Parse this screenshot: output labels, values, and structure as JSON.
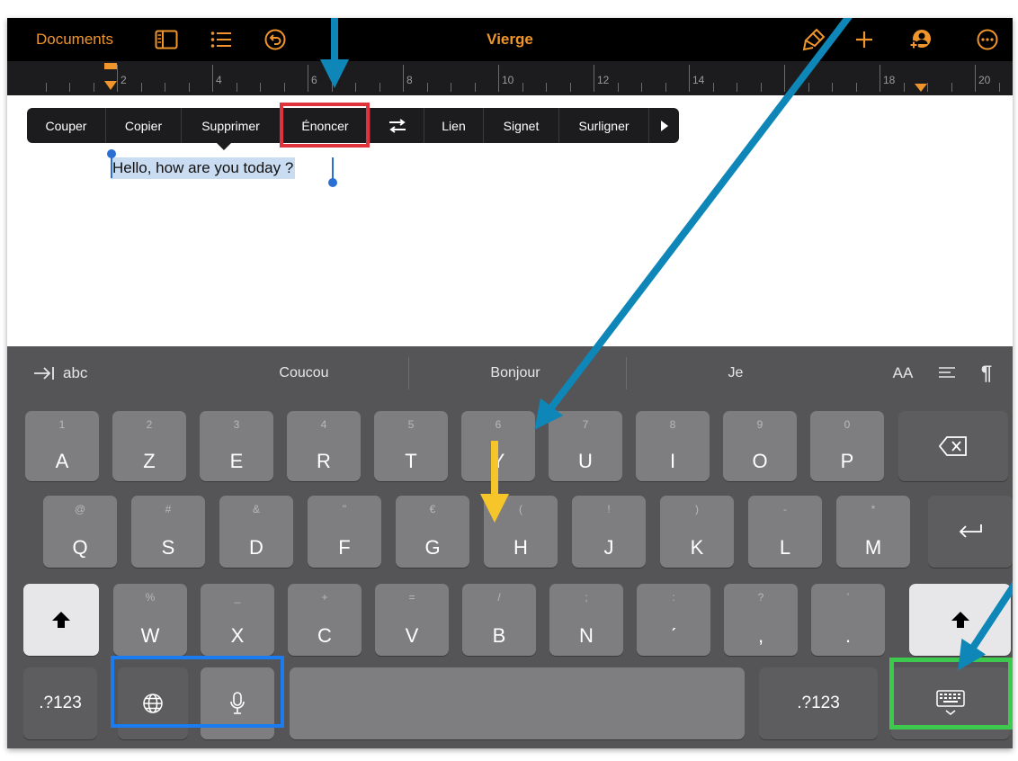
{
  "toolbar": {
    "documents_label": "Documents",
    "title": "Vierge",
    "icons": [
      "sidebar-icon",
      "list-icon",
      "undo-icon",
      "brush-icon",
      "plus-icon",
      "collaborate-icon",
      "more-icon"
    ]
  },
  "ruler": {
    "labels": [
      "2",
      "4",
      "6",
      "8",
      "10",
      "12",
      "14",
      "18",
      "20"
    ]
  },
  "edit_menu": {
    "items": [
      "Couper",
      "Copier",
      "Supprimer",
      "Énoncer",
      "",
      "Lien",
      "Signet",
      "Surligner",
      ""
    ],
    "highlighted_item": "Énoncer"
  },
  "document": {
    "selected_text": "Hello, how are you today ?"
  },
  "keyboard": {
    "predictions": {
      "tab_label": "abc",
      "words": [
        "Coucou",
        "Bonjour",
        "Je"
      ],
      "format_label": "AA"
    },
    "row1": [
      {
        "sub": "1",
        "main": "A"
      },
      {
        "sub": "2",
        "main": "Z"
      },
      {
        "sub": "3",
        "main": "E"
      },
      {
        "sub": "4",
        "main": "R"
      },
      {
        "sub": "5",
        "main": "T"
      },
      {
        "sub": "6",
        "main": "Y"
      },
      {
        "sub": "7",
        "main": "U"
      },
      {
        "sub": "8",
        "main": "I"
      },
      {
        "sub": "9",
        "main": "O"
      },
      {
        "sub": "0",
        "main": "P"
      }
    ],
    "row2": [
      {
        "sub": "@",
        "main": "Q"
      },
      {
        "sub": "#",
        "main": "S"
      },
      {
        "sub": "&",
        "main": "D"
      },
      {
        "sub": "\"",
        "main": "F"
      },
      {
        "sub": "€",
        "main": "G"
      },
      {
        "sub": "(",
        "main": "H"
      },
      {
        "sub": "!",
        "main": "J"
      },
      {
        "sub": ")",
        "main": "K"
      },
      {
        "sub": "-",
        "main": "L"
      },
      {
        "sub": "*",
        "main": "M"
      }
    ],
    "row3": [
      {
        "sub": "%",
        "main": "W"
      },
      {
        "sub": "_",
        "main": "X"
      },
      {
        "sub": "+",
        "main": "C"
      },
      {
        "sub": "=",
        "main": "V"
      },
      {
        "sub": "/",
        "main": "B"
      },
      {
        "sub": ";",
        "main": "N"
      },
      {
        "sub": ":",
        "main": "ˊ"
      },
      {
        "sub": "?",
        "main": ","
      },
      {
        "sub": "ʼ",
        "main": "."
      }
    ],
    "numbers_label": ".?123",
    "numbers_label_right": ".?123"
  },
  "colors": {
    "toolbar_accent": "#f0952b",
    "annotation_arrow": "#0e87b8",
    "annotation_yellow": "#f5c52a",
    "highlight_red": "#e0323a",
    "highlight_blue": "#1a7cf0",
    "highlight_green": "#3dc84e"
  }
}
